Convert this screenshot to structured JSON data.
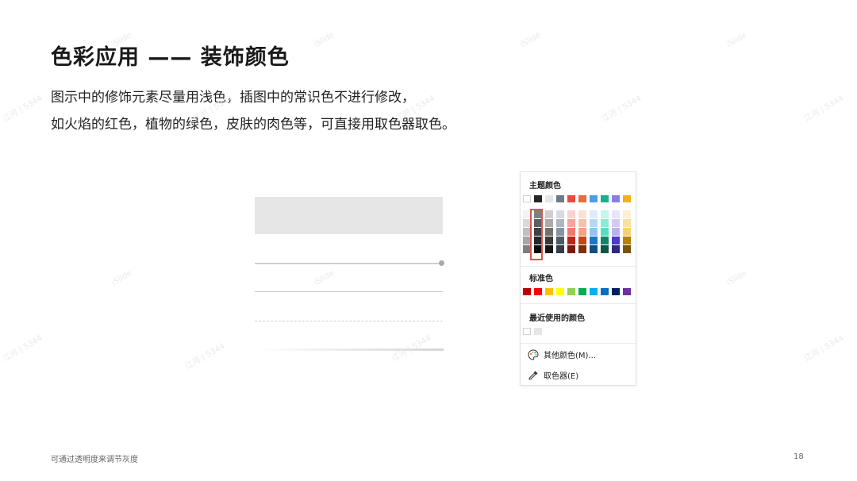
{
  "slide": {
    "title": "色彩应用 —— 装饰颜色",
    "desc_line1": "图示中的修饰元素尽量用浅色，插图中的常识色不进行修改，",
    "desc_line2": "如火焰的红色，植物的绿色，皮肤的肉色等，可直接用取色器取色。",
    "footer_note": "可通过透明度来调节灰度",
    "page_number": "18",
    "watermarks": [
      "iSlide",
      "江河 | 5344"
    ]
  },
  "picker": {
    "theme_label": "主题颜色",
    "theme_colors": [
      "#ffffff",
      "#262626",
      "#e7e6e6",
      "#6c7a89",
      "#e84c3d",
      "#ec6a3c",
      "#4c9ee6",
      "#1aaf8c",
      "#8b7ee3",
      "#f2b21b"
    ],
    "shade_columns": [
      [
        "#f2f2f2",
        "#d9d9d9",
        "#bfbfbf",
        "#a6a6a6",
        "#7f7f7f"
      ],
      [
        "#808080",
        "#5e5e5e",
        "#404040",
        "#262626",
        "#0d0d0d"
      ],
      [
        "#d0cece",
        "#aeaaaa",
        "#757070",
        "#3b3838",
        "#171616"
      ],
      [
        "#d6dbe1",
        "#adb7c2",
        "#8593a4",
        "#4f5b67",
        "#353d45"
      ],
      [
        "#fad2cf",
        "#f6a59e",
        "#f1786d",
        "#b9261a",
        "#7b1911"
      ],
      [
        "#fbe0d5",
        "#f7c1ac",
        "#f4a283",
        "#c44413",
        "#832d0d"
      ],
      [
        "#dbebfa",
        "#b7d8f5",
        "#94c4f0",
        "#1c74c4",
        "#134d83"
      ],
      [
        "#c6f5ea",
        "#8debd5",
        "#55e1c0",
        "#128368",
        "#0c5745"
      ],
      [
        "#e8e5f9",
        "#d1cbf4",
        "#b9b2ee",
        "#4a3bc8",
        "#31277f"
      ],
      [
        "#fcf0d1",
        "#fae0a4",
        "#f7d176",
        "#b78109",
        "#7a5606"
      ]
    ],
    "standard_label": "标准色",
    "standard_colors": [
      "#c00000",
      "#ff0000",
      "#ffc000",
      "#ffff00",
      "#92d050",
      "#00b050",
      "#00b0f0",
      "#0070c0",
      "#002060",
      "#7030a0"
    ],
    "recent_label": "最近使用的颜色",
    "recent_colors": [
      "#ffffff",
      "#e6e6e6"
    ],
    "more_colors": "其他颜色(M)...",
    "eyedropper": "取色器(E)"
  }
}
